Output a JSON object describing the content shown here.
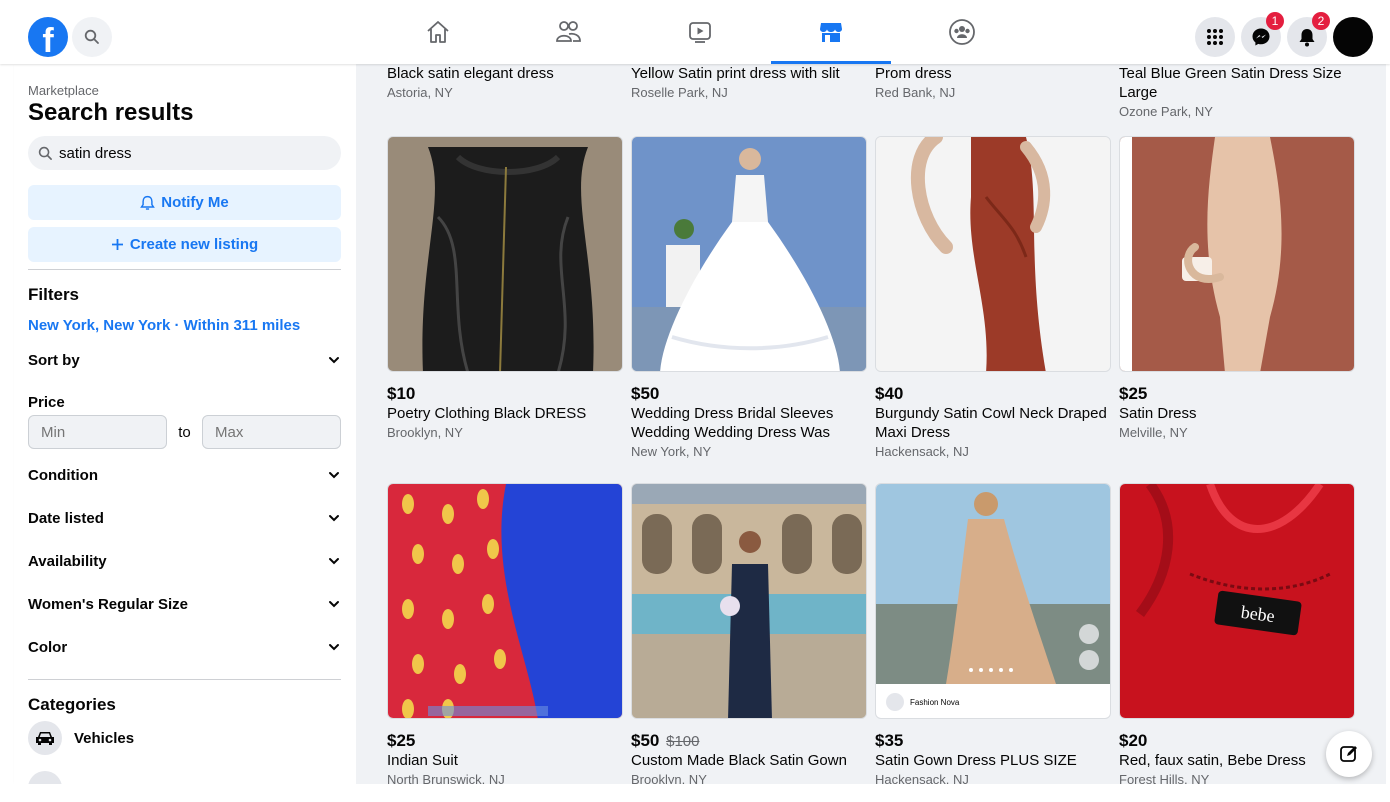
{
  "colors": {
    "brand": "#1877f2",
    "badge": "#e41e3f",
    "background": "#f0f2f5"
  },
  "topbar": {
    "logo_letter": "f",
    "nav": [
      {
        "name": "home",
        "icon": "home-icon"
      },
      {
        "name": "friends",
        "icon": "friends-icon"
      },
      {
        "name": "watch",
        "icon": "video-icon"
      },
      {
        "name": "marketplace",
        "icon": "marketplace-icon",
        "active": true
      },
      {
        "name": "groups",
        "icon": "groups-icon"
      }
    ],
    "messenger_badge": "1",
    "notifications_badge": "2"
  },
  "sidebar": {
    "breadcrumb": "Marketplace",
    "title": "Search results",
    "search_value": "satin dress",
    "notify_label": "Notify Me",
    "create_label": "Create new listing",
    "filters_heading": "Filters",
    "location": "New York, New York · Within 311 miles",
    "sort_by": "Sort by",
    "price_label": "Price",
    "price_min_placeholder": "Min",
    "price_to": "to",
    "price_max_placeholder": "Max",
    "filters": [
      "Condition",
      "Date listed",
      "Availability",
      "Women's Regular Size",
      "Color"
    ],
    "categories_heading": "Categories",
    "category_first": "Vehicles"
  },
  "top_row": [
    {
      "title": "Black satin elegant dress",
      "location": "Astoria, NY"
    },
    {
      "title": "Yellow Satin print dress with slit",
      "location": "Roselle Park, NJ"
    },
    {
      "title": "Prom dress",
      "location": "Red Bank, NJ"
    },
    {
      "title": "Teal Blue Green Satin Dress Size Large",
      "location": "Ozone Park, NY"
    }
  ],
  "listings": [
    {
      "price": "$10",
      "title": "Poetry Clothing Black DRESS",
      "location": "Brooklyn, NY"
    },
    {
      "price": "$50",
      "title": "Wedding Dress Bridal Sleeves Wedding Wedding Dress Was Thin...",
      "location": "New York, NY"
    },
    {
      "price": "$40",
      "title": "Burgundy Satin Cowl Neck Draped Maxi Dress",
      "location": "Hackensack, NJ"
    },
    {
      "price": "$25",
      "title": "Satin Dress",
      "location": "Melville, NY"
    },
    {
      "price": "$25",
      "title": "Indian Suit",
      "location": "North Brunswick, NJ"
    },
    {
      "price": "$50",
      "old_price": "$100",
      "title": "Custom Made Black Satin Gown",
      "location": "Brooklyn, NY"
    },
    {
      "price": "$35",
      "title": "Satin Gown Dress PLUS SIZE",
      "location": "Hackensack, NJ",
      "brand_tag": "Fashion Nova"
    },
    {
      "price": "$20",
      "title": "Red, faux satin, Bebe Dress",
      "location": "Forest Hills, NY",
      "label_text": "bebe"
    }
  ]
}
